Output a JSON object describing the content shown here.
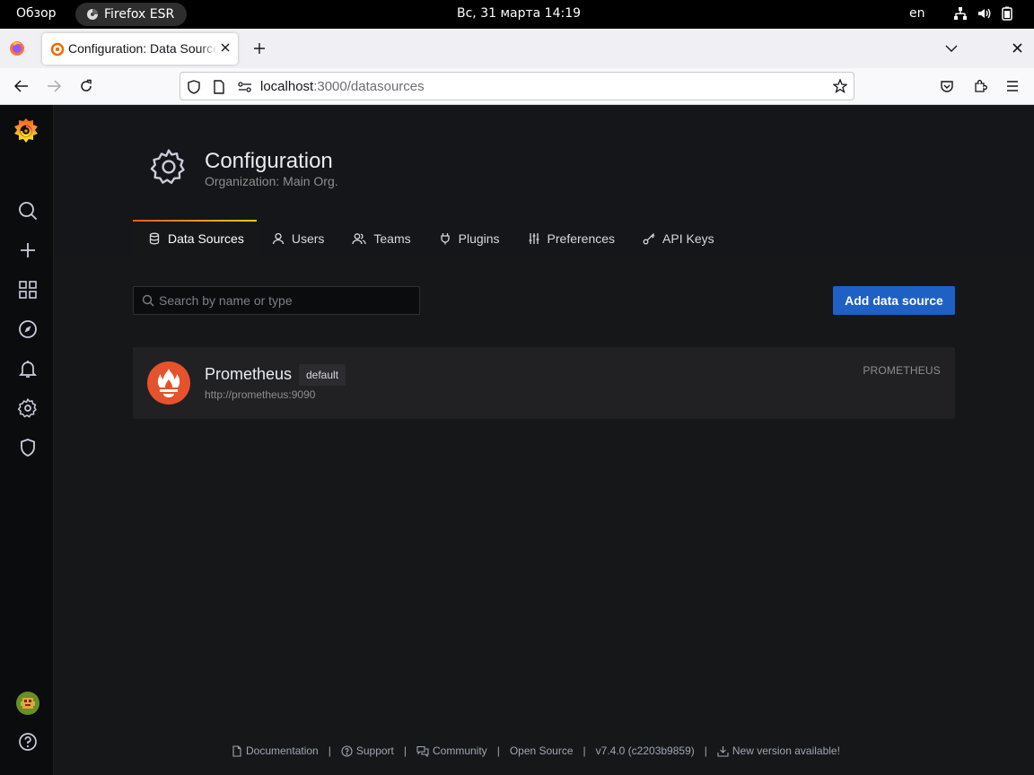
{
  "system_bar": {
    "overview_label": "Обзор",
    "app_name": "Firefox ESR",
    "clock": "Вс, 31 марта  14:19",
    "keyboard_layout": "en"
  },
  "browser": {
    "tab": {
      "title": "Configuration: Data Sources - Grafana"
    },
    "url": {
      "host": "localhost",
      "rest": ":3000/datasources"
    }
  },
  "grafana": {
    "sidemenu": {
      "items": [
        "search-icon",
        "plus-icon",
        "dashboards-icon",
        "explore-icon",
        "alerting-icon",
        "configuration-icon",
        "server-admin-icon"
      ],
      "bottom": [
        "user-avatar",
        "help-icon"
      ]
    },
    "header": {
      "title": "Configuration",
      "subtitle": "Organization: Main Org."
    },
    "tabs": [
      {
        "label": "Data Sources",
        "icon": "database-icon",
        "active": true
      },
      {
        "label": "Users",
        "icon": "user-icon",
        "active": false
      },
      {
        "label": "Teams",
        "icon": "users-icon",
        "active": false
      },
      {
        "label": "Plugins",
        "icon": "plug-icon",
        "active": false
      },
      {
        "label": "Preferences",
        "icon": "sliders-icon",
        "active": false
      },
      {
        "label": "API Keys",
        "icon": "key-icon",
        "active": false
      }
    ],
    "search": {
      "placeholder": "Search by name or type",
      "value": ""
    },
    "add_button": "Add data source",
    "datasources": [
      {
        "name": "Prometheus",
        "badge": "default",
        "url": "http://prometheus:9090",
        "type": "PROMETHEUS"
      }
    ],
    "footer": {
      "documentation": "Documentation",
      "support": "Support",
      "community": "Community",
      "open_source": "Open Source",
      "version": "v7.4.0 (c2203b9859)",
      "new_version": "New version available!",
      "separator": "|"
    },
    "colors": {
      "accent_blue": "#1f60c4",
      "tab_gradient_start": "#f05a28",
      "tab_gradient_end": "#fbca0a",
      "prometheus": "#e6522c"
    }
  }
}
